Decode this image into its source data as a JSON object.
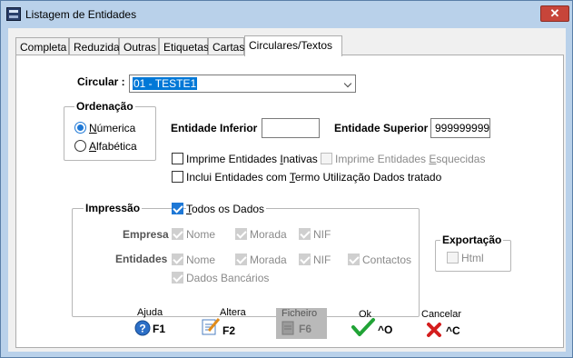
{
  "window": {
    "title": "Listagem de Entidades",
    "close_label": "✕"
  },
  "tabs": [
    {
      "label": "Completa"
    },
    {
      "label": "Reduzida"
    },
    {
      "label": "Outras"
    },
    {
      "label": "Etiquetas"
    },
    {
      "label": "Cartas"
    },
    {
      "label": "Circulares/Textos",
      "active": true
    }
  ],
  "circular": {
    "label": "Circular :",
    "value": "01 - TESTE1"
  },
  "ordenacao": {
    "title": "Ordenação",
    "numerica": {
      "label_pre": "",
      "label_u": "N",
      "label_post": "úmerica",
      "selected": true
    },
    "alfabetica": {
      "label_u": "A",
      "label_post": "lfabética",
      "selected": false
    }
  },
  "entidade_inferior": {
    "label": "Entidade Inferior",
    "value": ""
  },
  "entidade_superior": {
    "label": "Entidade Superior",
    "value": "999999999"
  },
  "options": {
    "imprime_inativas": {
      "label_pre": "Imprime Entidades ",
      "label_u": "I",
      "label_post": "nativas",
      "checked": false
    },
    "imprime_esquecidas": {
      "label_pre": "Imprime Entidades ",
      "label_u": "E",
      "label_post": "squecidas",
      "checked": false,
      "disabled": true
    },
    "termo_utilizacao": {
      "label_pre": "Inclui Entidades com ",
      "label_u": "T",
      "label_post": "ermo Utilização Dados tratado",
      "checked": false
    }
  },
  "impressao": {
    "title": "Impressão",
    "todos_dados": {
      "label_u": "T",
      "label_post": "odos os Dados",
      "checked": true
    },
    "empresa": {
      "label": "Empresa",
      "nome": "Nome",
      "morada": "Morada",
      "nif": "NIF"
    },
    "entidades": {
      "label": "Entidades",
      "nome": "Nome",
      "morada": "Morada",
      "nif": "NIF",
      "contactos": "Contactos"
    },
    "dados_bancarios": "Dados Bancários"
  },
  "exportacao": {
    "title": "Exportação",
    "html": "Html"
  },
  "toolbar": [
    {
      "caption": "Ajuda",
      "key": "F1",
      "icon": "help-icon"
    },
    {
      "caption": "Altera",
      "key": "F2",
      "icon": "edit-icon"
    },
    {
      "caption": "Ficheiro",
      "key": "F6",
      "icon": "file-icon",
      "disabled": true
    },
    {
      "caption": "Ok",
      "key": "^O",
      "icon": "check-icon"
    },
    {
      "caption": "Cancelar",
      "key": "^C",
      "icon": "cancel-icon"
    }
  ]
}
